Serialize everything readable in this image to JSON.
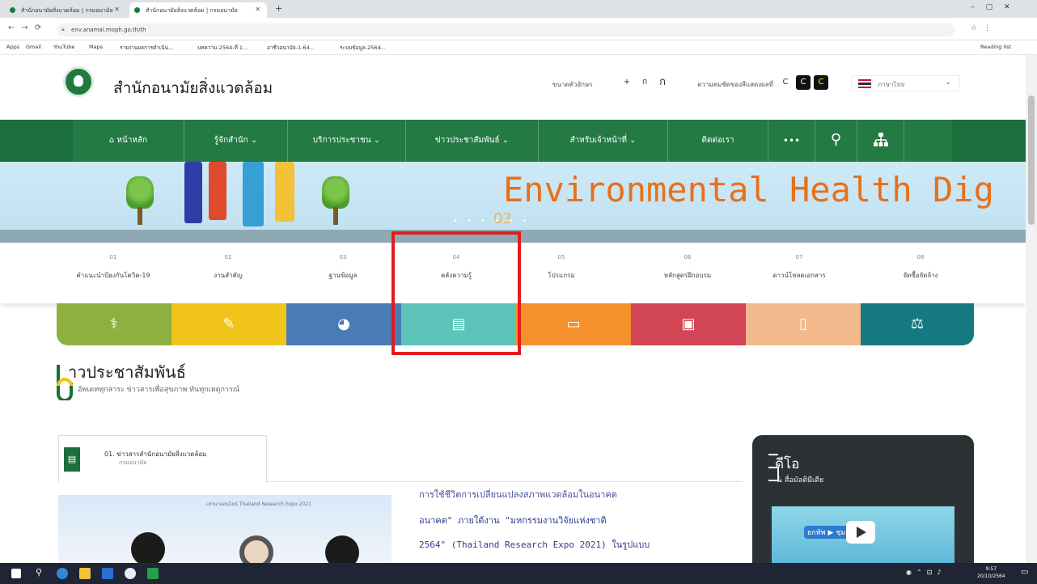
{
  "browser": {
    "tabs": [
      {
        "title": "สำนักอนามัยสิ่งแวดล้อม | กรมอนามัย"
      },
      {
        "title": "สำนักอนามัยสิ่งแวดล้อม | กรมอนามัย"
      }
    ],
    "url": "env.anamai.moph.go.th/th",
    "bookmarks": [
      "Apps",
      "Gmail",
      "YouTube",
      "Maps",
      "รายงานผลการดำเนิน...",
      "บทความ-2564-ที่ 1...",
      "อาชีวอนามัย-1-64...",
      "ระบบข้อมูล-2564..."
    ],
    "reading_list": "Reading list"
  },
  "header": {
    "site_title": "สำนักอนามัยสิ่งแวดล้อม",
    "font_size_label": "ขนาดตัวอักษร",
    "font_buttons": [
      "+",
      "ก",
      "ก"
    ],
    "contrast_label": "ความคมชัดของสีแสดงผลที่",
    "contrast_buttons": [
      "C",
      "C",
      "C"
    ],
    "language": "ภาษาไทย"
  },
  "nav": {
    "items": [
      "หน้าหลัก",
      "รู้จักสำนัก ⌄",
      "บริการประชาชน ⌄",
      "ข่าวประชาสัมพันธ์ ⌄",
      "สำหรับเจ้าหน้าที่ ⌄",
      "ติดต่อเรา",
      "•••"
    ],
    "home_icon": "home-icon",
    "search_icon": "search-icon",
    "sitemap_icon": "sitemap-icon"
  },
  "banner": {
    "text": "Environmental Health Dig",
    "slide_number": "03",
    "slide_dots": "• • • • • •"
  },
  "tiles": [
    {
      "num": "01",
      "label": "คำแนะนำป้องกันโควิด-19"
    },
    {
      "num": "02",
      "label": "งานสำคัญ"
    },
    {
      "num": "03",
      "label": "ฐานข้อมูล"
    },
    {
      "num": "04",
      "label": "คลังความรู้"
    },
    {
      "num": "05",
      "label": "โปรแกรม"
    },
    {
      "num": "06",
      "label": "หลักสูตรฝึกอบรม"
    },
    {
      "num": "07",
      "label": "ดาวน์โหลดเอกสาร"
    },
    {
      "num": "08",
      "label": "จัดซื้อจัดจ้าง"
    }
  ],
  "colorbar": {
    "blocks": [
      {
        "icon": "stethoscope-icon",
        "glyph": "⚕",
        "color": "#8db13e"
      },
      {
        "icon": "edit-icon",
        "glyph": "✎",
        "color": "#f0c419"
      },
      {
        "icon": "pie-chart-icon",
        "glyph": "◕",
        "color": "#4a7bb5"
      },
      {
        "icon": "book-icon",
        "glyph": "▤",
        "color": "#5cc4b9"
      },
      {
        "icon": "laptop-icon",
        "glyph": "▭",
        "color": "#f4912a"
      },
      {
        "icon": "id-card-icon",
        "glyph": "▣",
        "color": "#d24555"
      },
      {
        "icon": "document-icon",
        "glyph": "▯",
        "color": "#f2b98c"
      },
      {
        "icon": "scales-icon",
        "glyph": "⚖",
        "color": "#157a80"
      }
    ]
  },
  "news": {
    "title": "าวประชาสัมพันธ์",
    "subtitle": "อัพเดททุกสาระ ข่าวสารเพื่อสุขภาพ ทันทุกเหตุการณ์",
    "card_label": "01. ข่าวสารสำนักอนามัยสิ่งแวดล้อม",
    "card_sublabel": "กรมอนามัย",
    "card_icon": "▤",
    "image_caption": "เสวนาออนไลน์ Thailand Research Expo 2021",
    "lines": [
      "การใช้ชีวิตการเปลี่ยนแปลงสภาพแวดล้อมในอนาคต",
      "อนาคต\" ภายใต้งาน \"มหกรรมงานวิจัยแห่งชาติ",
      "2564\" (Thailand Research Expo 2021) ในรูปแบบ"
    ]
  },
  "video": {
    "title": "ดีโอ",
    "subtitle": "& สื่อมัลติมีเดีย",
    "thumb_text": "ยกทัพ ▶ ชุมชน"
  },
  "taskbar": {
    "time": "9:57",
    "date": "20/10/2564"
  }
}
